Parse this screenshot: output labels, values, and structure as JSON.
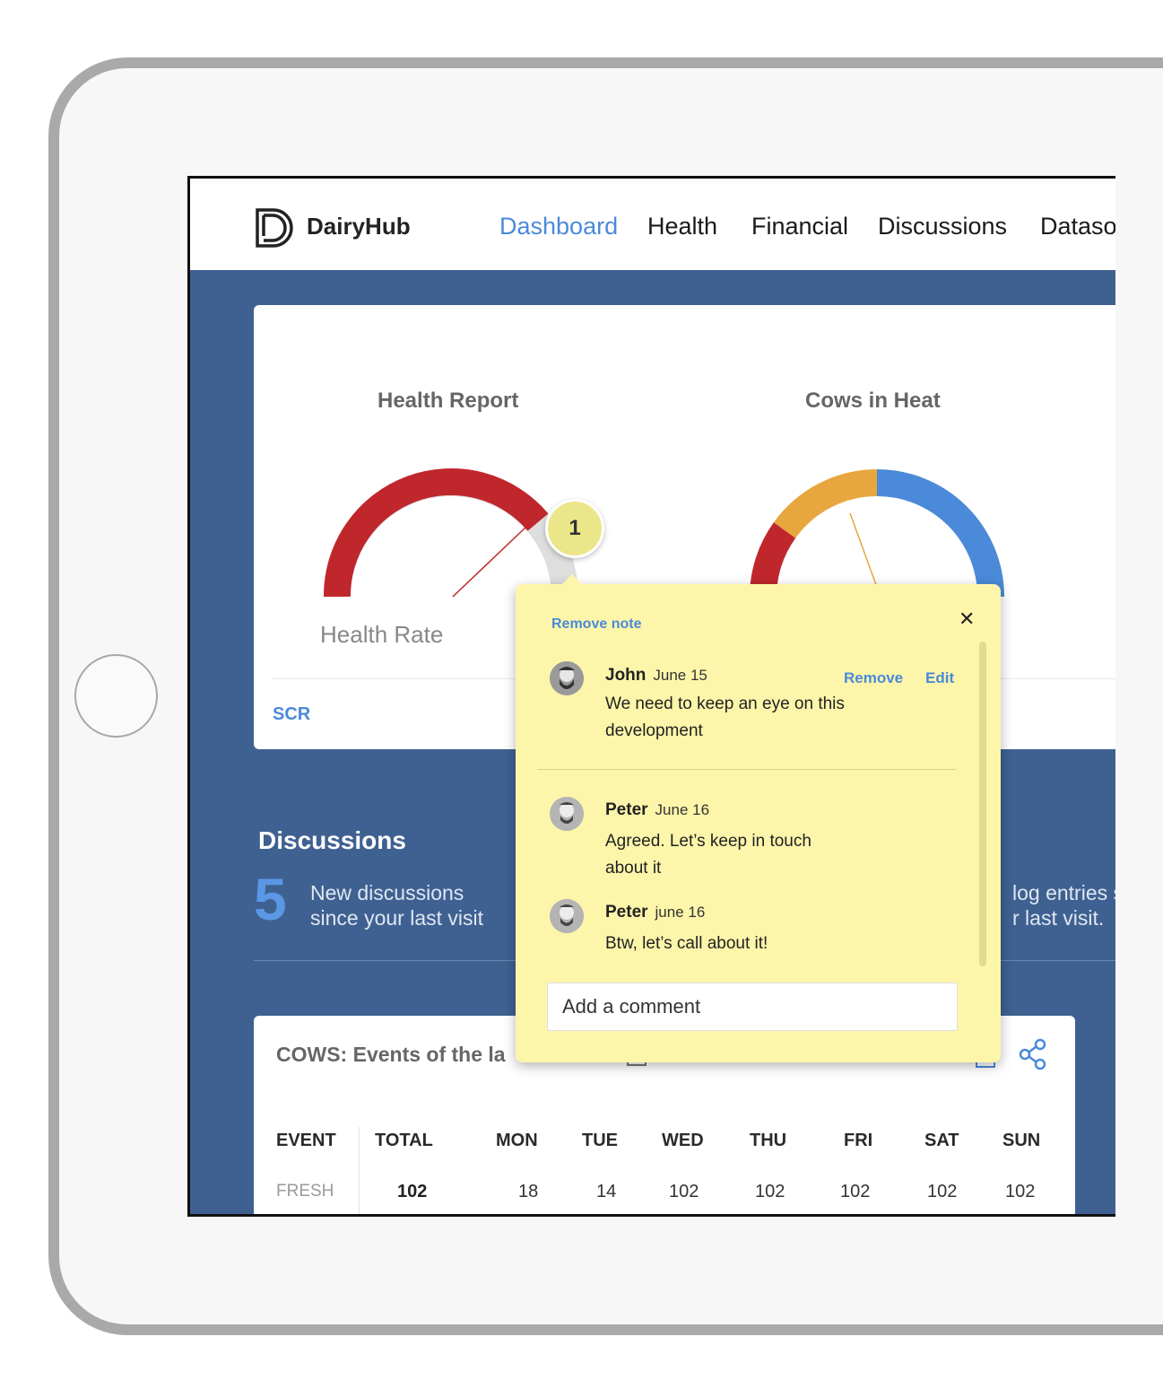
{
  "app": {
    "name": "DairyHub"
  },
  "nav": {
    "items": [
      {
        "label": "Dashboard",
        "active": true
      },
      {
        "label": "Health"
      },
      {
        "label": "Financial"
      },
      {
        "label": "Discussions"
      },
      {
        "label": "Dataso"
      }
    ]
  },
  "gauges": {
    "health": {
      "title": "Health Report",
      "label": "Health Rate"
    },
    "heat": {
      "title": "Cows in Heat"
    },
    "footer_link": "SCR"
  },
  "discussions": {
    "title": "Discussions",
    "count": "5",
    "text_line1": "New discussions",
    "text_line2": "since your last visit",
    "log_line1": "log entries s",
    "log_line2": "r last visit."
  },
  "events": {
    "title": "COWS: Events of the la",
    "columns": [
      "EVENT",
      "TOTAL",
      "MON",
      "TUE",
      "WED",
      "THU",
      "FRI",
      "SAT",
      "SUN"
    ],
    "rows": [
      {
        "event": "FRESH",
        "total": "102",
        "mon": "18",
        "tue": "14",
        "wed": "102",
        "thu": "102",
        "fri": "102",
        "sat": "102",
        "sun": "102"
      }
    ]
  },
  "note": {
    "badge": "1",
    "remove_note": "Remove note",
    "close": "✕",
    "comments": [
      {
        "name": "John",
        "date": "June 15",
        "text": "We need to keep an eye on this development",
        "remove": "Remove",
        "edit": "Edit"
      },
      {
        "name": "Peter",
        "date": "June 16",
        "text": "Agreed. Let’s keep in touch about it"
      },
      {
        "name": "Peter",
        "date": "june 16",
        "text": "Btw, let’s call about it!"
      }
    ],
    "input_placeholder": "Add a comment"
  },
  "colors": {
    "background": "#3f6191",
    "accent": "#4a8ad9",
    "note": "#fdf6aa",
    "gauge_red": "#c0272d",
    "gauge_orange": "#e8a63e",
    "gauge_blue": "#4a8ad9"
  }
}
